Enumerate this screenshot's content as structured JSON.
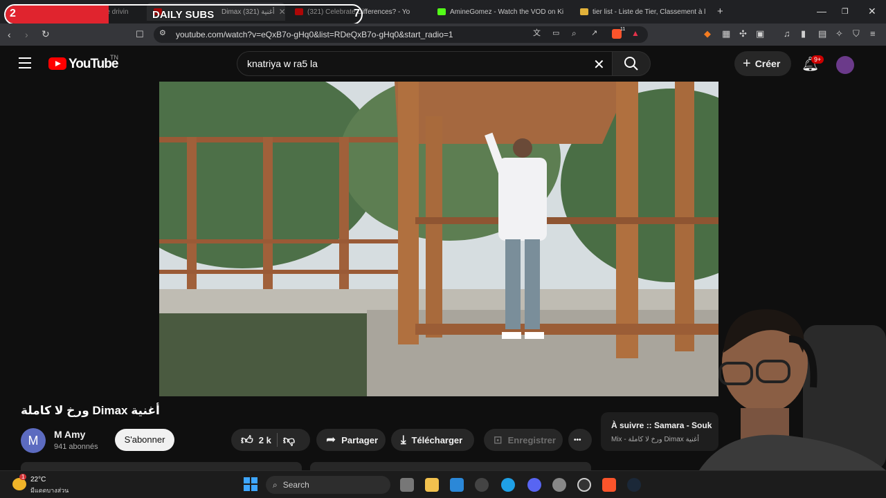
{
  "overlay": {
    "left_count": "2",
    "label": "DAILY SUBS",
    "right_count": "7",
    "fill_fraction": 0.29
  },
  "browser": {
    "tabs": [
      {
        "label": "re drivin",
        "close": ""
      },
      {
        "label": "Dimax أغنية (321)",
        "close": "✕"
      },
      {
        "label": "(321) Celebrate Differences? - Yo",
        "close": ""
      },
      {
        "label": "AmineGomez - Watch the VOD on Ki",
        "close": ""
      },
      {
        "label": "tier list - Liste de Tier, Classement à l",
        "close": ""
      }
    ],
    "new_tab": "+",
    "url": "youtube.com/watch?v=eQxB7o-gHq0&list=RDeQxB7o-gHq0&start_radio=1",
    "extension_badge": "11"
  },
  "youtube": {
    "logo_text": "YouTube",
    "country_code": "TN",
    "search_value": "knatriya w ra5 la",
    "create_label": "Créer",
    "notification_count": "9+"
  },
  "video": {
    "title": "ورخ لا كاملة Dimax أغنية",
    "channel_initial": "M",
    "channel_name": "M Amy",
    "subscribers": "941 abonnés",
    "subscribe_label": "S'abonner",
    "likes": "2 k",
    "share_label": "Partager",
    "download_label": "Télécharger",
    "save_label": "Enregistrer",
    "more_label": "•••"
  },
  "up_next": {
    "title": "À suivre :: Samara - Souk",
    "subtitle": "Mix - ورخ لا كاملة Dimax أغنية"
  },
  "taskbar": {
    "temperature": "22°C",
    "weather_desc": "มีแดดบางส่วน",
    "weather_badge": "1",
    "search_label": "Search"
  },
  "colors": {
    "yt_red": "#ff0000",
    "overlay_red": "#e0242e",
    "background": "#0f0f0f"
  }
}
